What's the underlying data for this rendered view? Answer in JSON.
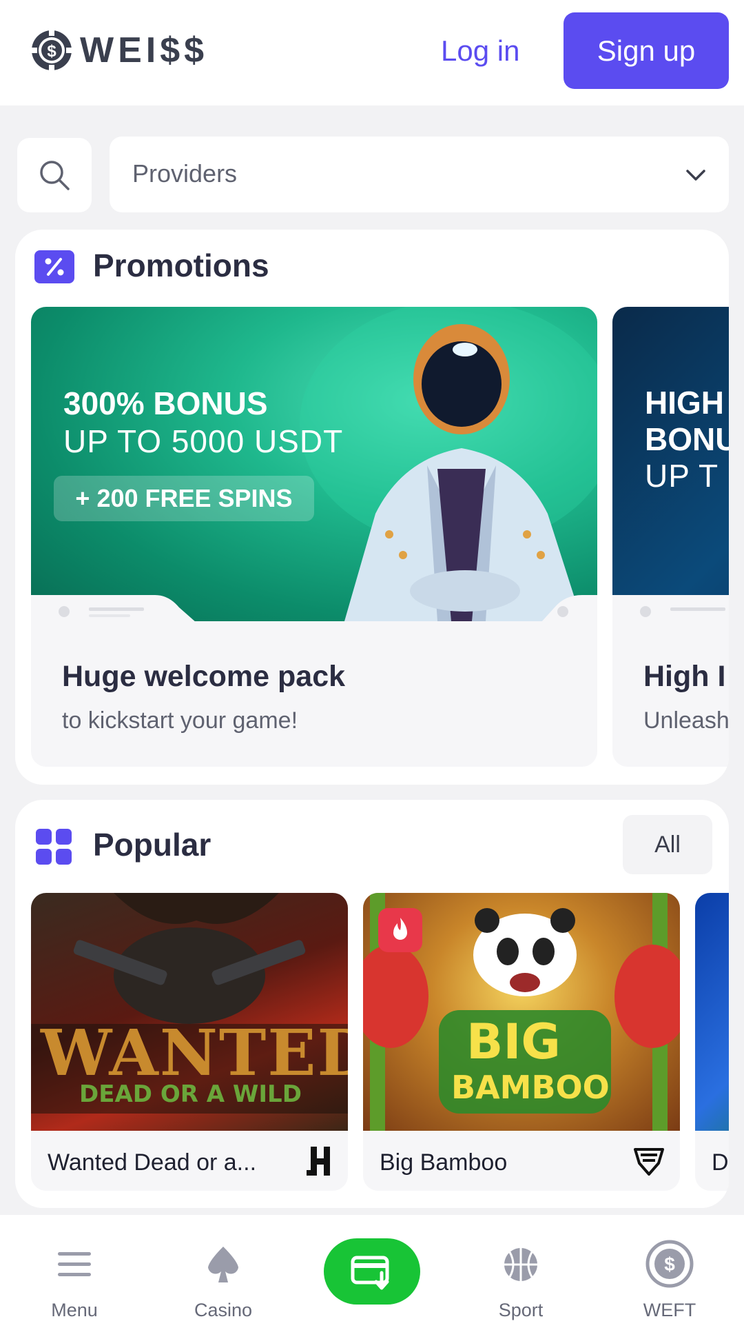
{
  "header": {
    "logo_text": "WEI$$",
    "login_label": "Log in",
    "signup_label": "Sign up"
  },
  "filters": {
    "search_icon": "search-icon",
    "providers_label": "Providers",
    "providers_icon": "chevron-down-icon"
  },
  "promotions": {
    "title": "Promotions",
    "icon": "percent-icon",
    "cards": [
      {
        "banner_line1": "300% BONUS",
        "banner_line2": "UP TO 5000 USDT",
        "banner_badge": "+ 200 FREE SPINS",
        "title": "Huge welcome pack",
        "subtitle": "to kickstart your game!"
      },
      {
        "banner_line1": "HIGH",
        "banner_line2": "BONU",
        "banner_line3": "UP T",
        "title": "High I",
        "subtitle": "Unleash"
      }
    ]
  },
  "popular": {
    "title": "Popular",
    "icon": "grid-icon",
    "all_label": "All",
    "games": [
      {
        "name": "Wanted Dead or a...",
        "thumb_title": "WANTED",
        "thumb_sub": "DEAD OR A WILD",
        "provider_icon": "hacksaw-logo-icon"
      },
      {
        "name": "Big Bamboo",
        "thumb_title": "BIG",
        "thumb_sub": "BAMBOO",
        "badge_icon": "flame-icon",
        "provider_icon": "push-gaming-logo-icon"
      },
      {
        "name": "D"
      }
    ]
  },
  "bottom_nav": {
    "items": [
      {
        "label": "Menu",
        "icon": "menu-icon"
      },
      {
        "label": "Casino",
        "icon": "spade-icon"
      },
      {
        "label": "",
        "icon": "wallet-deposit-icon"
      },
      {
        "label": "Sport",
        "icon": "basketball-icon"
      },
      {
        "label": "WEFT",
        "icon": "weft-coin-icon"
      }
    ]
  },
  "colors": {
    "accent": "#5b4cf0",
    "cashier_green": "#18c436",
    "page_bg": "#f2f2f4"
  }
}
